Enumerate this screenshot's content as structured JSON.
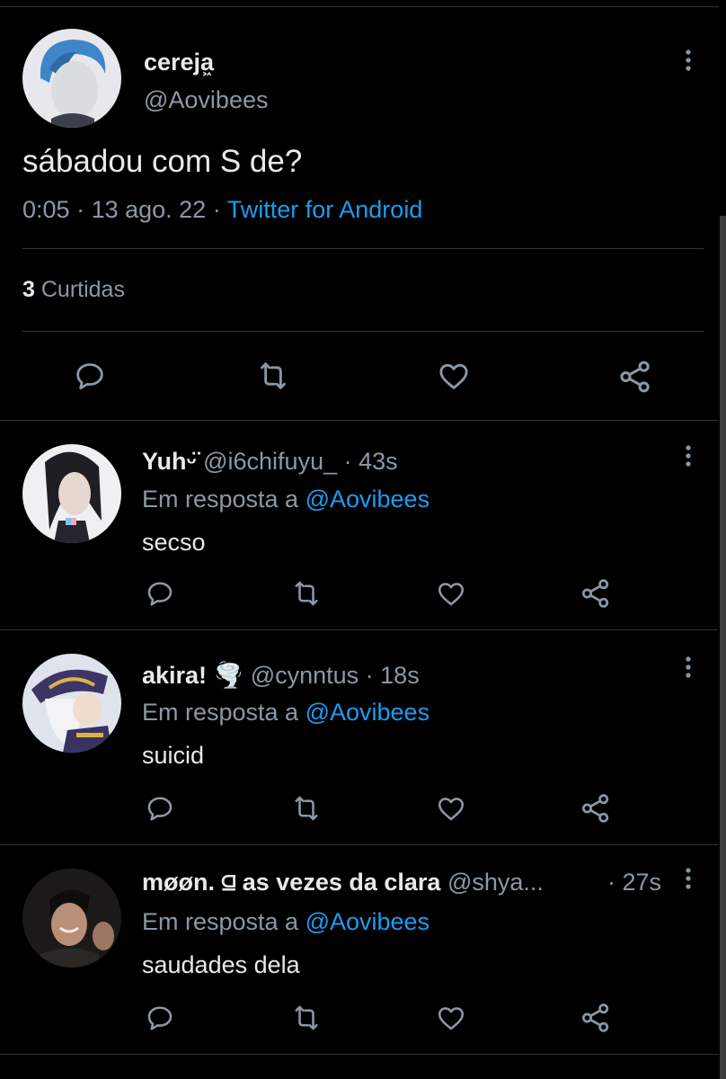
{
  "colors": {
    "background": "#000000",
    "text": "#e7e9ea",
    "muted": "#8b98a5",
    "accent": "#1d9bf0",
    "divider": "#2f3336"
  },
  "tweet": {
    "name": "cereja͖",
    "handle": "@Aovibees",
    "text": "sábadou com S de?",
    "time": "0:05",
    "date": "13 ago. 22",
    "source": "Twitter for Android",
    "likes_count": "3",
    "likes_label": "Curtidas",
    "actions": [
      "reply-icon",
      "retweet-icon",
      "like-icon",
      "share-icon"
    ]
  },
  "replies": [
    {
      "name": "Yuhᵕ̈",
      "handle": "@i6chifuyu_",
      "time": "· 43s",
      "in_reply_prefix": "Em resposta a",
      "in_reply_handle": "@Aovibees",
      "text": "secso"
    },
    {
      "name": "akira! 🌪️",
      "handle": "@cynntus",
      "time": "· 18s",
      "in_reply_prefix": "Em resposta a",
      "in_reply_handle": "@Aovibees",
      "text": "suicid"
    },
    {
      "name": "møøn. ⫑ as vezes da clara",
      "handle": "@shya...",
      "time": "· 27s",
      "in_reply_prefix": "Em resposta a",
      "in_reply_handle": "@Aovibees",
      "text": "saudades dela"
    }
  ]
}
